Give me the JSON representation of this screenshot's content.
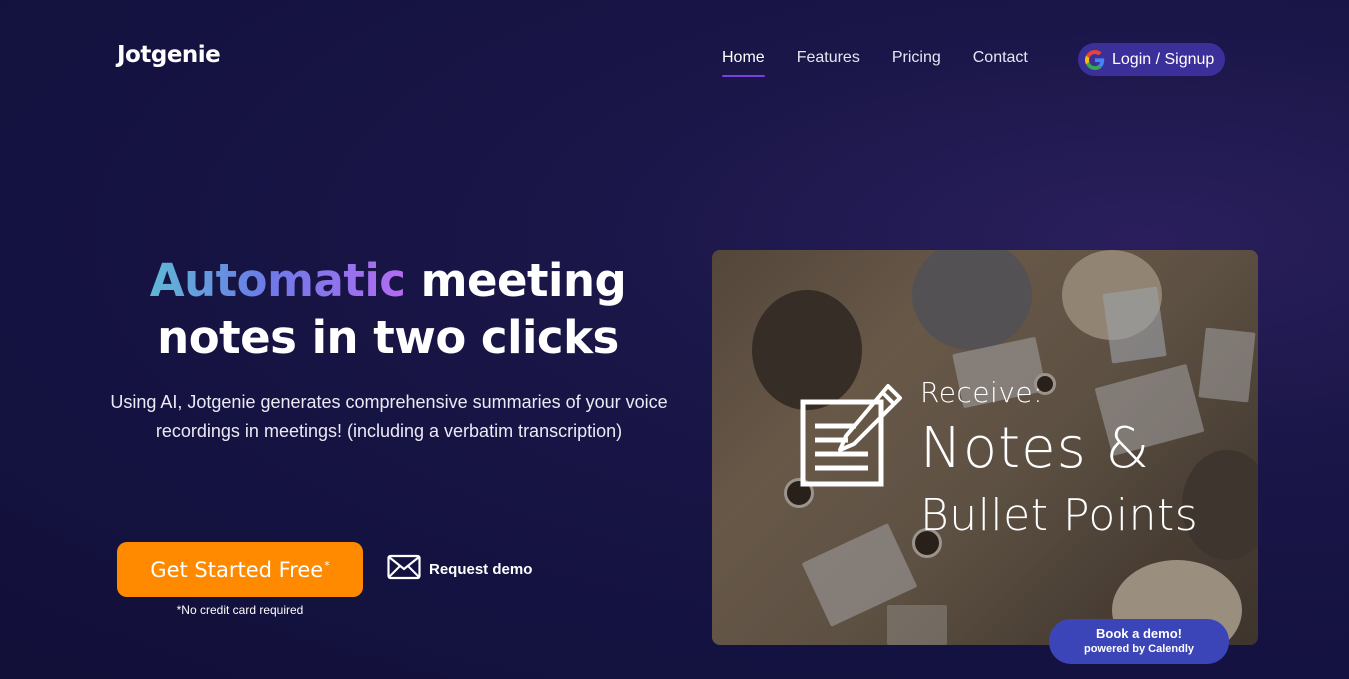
{
  "brand": {
    "name": "Jotgenie"
  },
  "nav": {
    "items": [
      {
        "label": "Home",
        "active": true
      },
      {
        "label": "Features",
        "active": false
      },
      {
        "label": "Pricing",
        "active": false
      },
      {
        "label": "Contact",
        "active": false
      }
    ],
    "login_label": "Login / Signup",
    "login_icon": "google-icon"
  },
  "hero": {
    "title_highlight": "Automatic",
    "title_rest_line1": " meeting",
    "title_line2": "notes in two clicks",
    "subtitle": "Using AI, Jotgenie generates comprehensive summaries of your voice recordings in meetings! (including a verbatim transcription)",
    "cta_label": "Get Started Free",
    "cta_mark": "*",
    "cta_note": "*No credit card required",
    "demo_label": "Request demo"
  },
  "media": {
    "line1": "Receive:",
    "line2": "Notes &",
    "line3": "Bullet Points"
  },
  "calendly": {
    "line1": "Book a demo!",
    "line2": "powered by Calendly"
  },
  "colors": {
    "background": "#141240",
    "accent_purple": "#7b3fe0",
    "cta_orange": "#ff8a00",
    "login_bg": "#3b2f9a",
    "calendly_bg": "#3b45b8"
  }
}
